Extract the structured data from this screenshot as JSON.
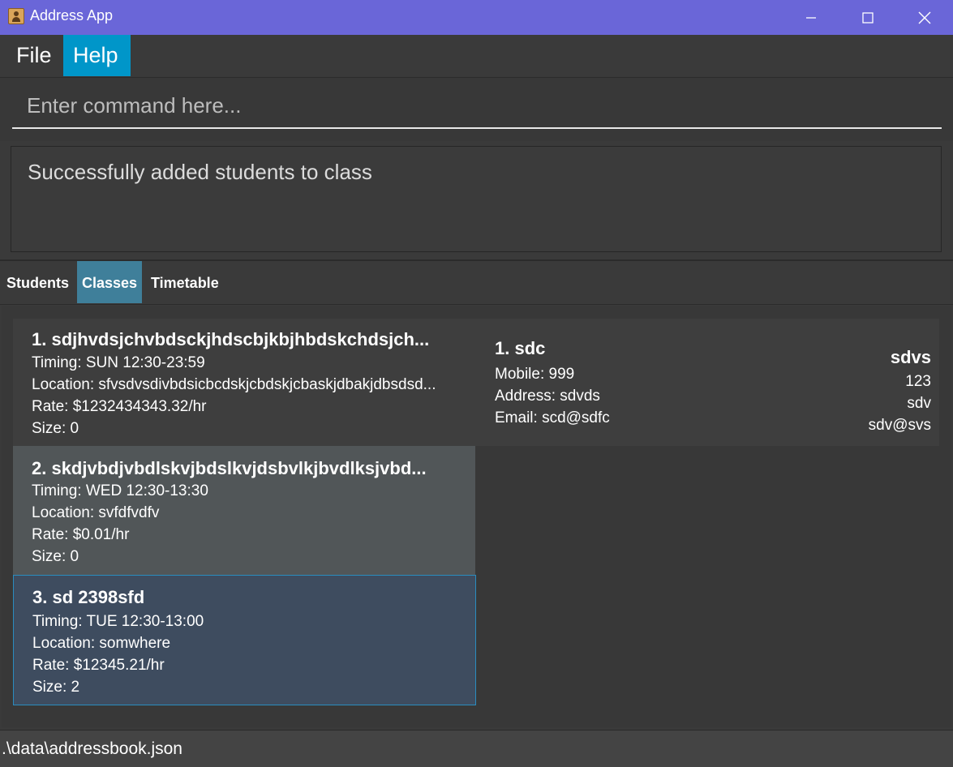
{
  "window": {
    "title": "Address App",
    "controls": [
      "minimize-icon",
      "maximize-icon",
      "close-icon"
    ]
  },
  "menu": {
    "file": "File",
    "help": "Help"
  },
  "command": {
    "placeholder": "Enter command here...",
    "value": ""
  },
  "result": {
    "message": "Successfully added students to class"
  },
  "tabs": {
    "students": "Students",
    "classes": "Classes",
    "timetable": "Timetable",
    "selected": "Classes"
  },
  "classes": [
    {
      "title": "1.  sdjhvdsjchvbdsckjhdscbjkbjhbdskchdsjch...",
      "timing": "Timing: SUN 12:30-23:59",
      "location": "Location: sfvsdvsdivbdsicbcdskjcbdskjcbaskjdbakjdbsdsd...",
      "rate": "Rate: $1232434343.32/hr",
      "size": "Size: 0"
    },
    {
      "title": "2.  skdjvbdjvbdlskvjbdslkvjdsbvlkjbvdlksjvbd...",
      "timing": "Timing: WED 12:30-13:30",
      "location": "Location: svfdfvdfv",
      "rate": "Rate: $0.01/hr",
      "size": "Size: 0"
    },
    {
      "title": "3.  sd    2398sfd",
      "timing": "Timing: TUE 12:30-13:00",
      "location": "Location: somwhere",
      "rate": "Rate: $12345.21/hr",
      "size": "Size: 2"
    }
  ],
  "student": {
    "name": "1.  sdc",
    "mobile": "Mobile: 999",
    "address": "Address: sdvds",
    "email": "Email: scd@sdfc",
    "parent_name": "sdvs",
    "parent_phone": "123",
    "parent_address": "sdv",
    "parent_email": "sdv@svs"
  },
  "status": {
    "path": ".\\data\\addressbook.json"
  },
  "colors": {
    "titlebar": "#6a66d8",
    "menu_active": "#0096c9",
    "tab_active": "#3f7f9a",
    "selected_border": "#2a8cbf"
  }
}
